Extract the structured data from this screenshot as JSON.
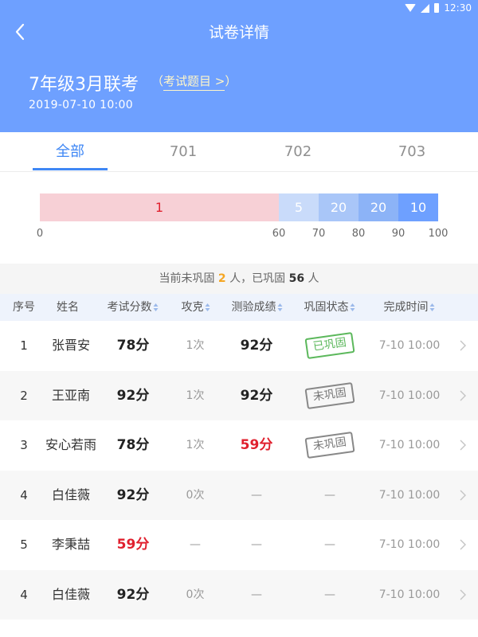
{
  "status": {
    "time": "12:30"
  },
  "header": {
    "title": "试卷详情",
    "exam_name": "7年级3月联考",
    "exam_link_open": "（",
    "exam_link": "考试题目 >",
    "exam_link_close": "）",
    "date": "2019-07-10  10:00"
  },
  "tabs": [
    {
      "label": "全部"
    },
    {
      "label": "701"
    },
    {
      "label": "702"
    },
    {
      "label": "703"
    }
  ],
  "distribution": {
    "segments": [
      {
        "count": "1",
        "from": 0,
        "to": 60,
        "color": "#f7d0d6",
        "text_color": "#e0202e"
      },
      {
        "count": "5",
        "from": 60,
        "to": 70,
        "color": "#c9dbfa",
        "text_color": "#ffffff"
      },
      {
        "count": "20",
        "from": 70,
        "to": 80,
        "color": "#a9c6f8",
        "text_color": "#ffffff"
      },
      {
        "count": "20",
        "from": 80,
        "to": 90,
        "color": "#8cb3f7",
        "text_color": "#ffffff"
      },
      {
        "count": "10",
        "from": 90,
        "to": 100,
        "color": "#6ea0ff",
        "text_color": "#ffffff"
      }
    ],
    "ticks": [
      "0",
      "60",
      "70",
      "80",
      "90",
      "100"
    ]
  },
  "summary": {
    "prefix": "当前未巩固 ",
    "unconsolidated": "2",
    "middle": " 人，已巩固 ",
    "consolidated": "56",
    "suffix": " 人"
  },
  "table": {
    "columns": [
      "序号",
      "姓名",
      "考试分数",
      "攻克",
      "测验成绩",
      "巩固状态",
      "完成时间"
    ],
    "rows": [
      {
        "idx": "1",
        "name": "张晋安",
        "score": "78分",
        "score_red": false,
        "attempts": "1次",
        "quiz": "92分",
        "quiz_red": false,
        "status": "已巩固",
        "status_type": "green",
        "time": "7-10  10:00"
      },
      {
        "idx": "2",
        "name": "王亚南",
        "score": "92分",
        "score_red": false,
        "attempts": "1次",
        "quiz": "92分",
        "quiz_red": false,
        "status": "未巩固",
        "status_type": "gray",
        "time": "7-10  10:00"
      },
      {
        "idx": "3",
        "name": "安心若雨",
        "score": "78分",
        "score_red": false,
        "attempts": "1次",
        "quiz": "59分",
        "quiz_red": true,
        "status": "未巩固",
        "status_type": "gray",
        "time": "7-10  10:00"
      },
      {
        "idx": "4",
        "name": "白佳薇",
        "score": "92分",
        "score_red": false,
        "attempts": "0次",
        "quiz": "—",
        "quiz_red": false,
        "status": "—",
        "status_type": "none",
        "time": "7-10  10:00"
      },
      {
        "idx": "5",
        "name": "李秉喆",
        "score": "59分",
        "score_red": true,
        "attempts": "—",
        "quiz": "—",
        "quiz_red": false,
        "status": "—",
        "status_type": "none",
        "time": "7-10  10:00"
      },
      {
        "idx": "4",
        "name": "白佳薇",
        "score": "92分",
        "score_red": false,
        "attempts": "0次",
        "quiz": "—",
        "quiz_red": false,
        "status": "—",
        "status_type": "none",
        "time": "7-10  10:00"
      }
    ]
  }
}
